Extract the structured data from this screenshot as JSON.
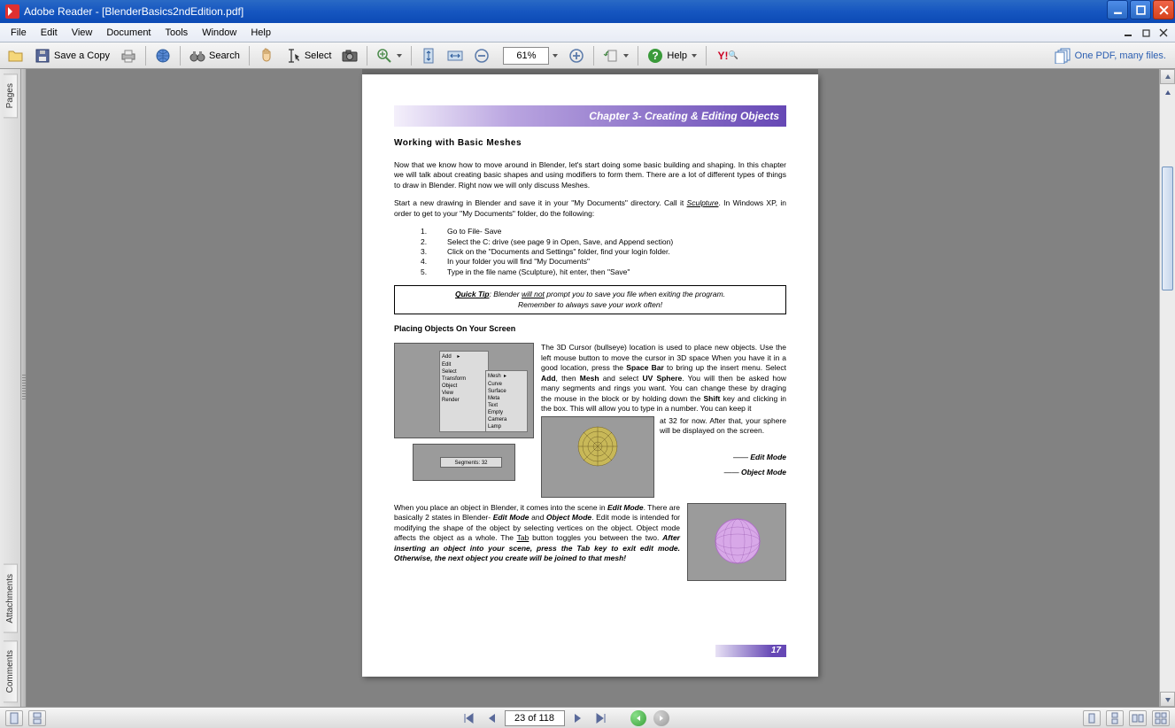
{
  "window": {
    "title": "Adobe Reader - [BlenderBasics2ndEdition.pdf]"
  },
  "menubar": {
    "items": [
      "File",
      "Edit",
      "View",
      "Document",
      "Tools",
      "Window",
      "Help"
    ]
  },
  "toolbar": {
    "save_copy": "Save a Copy",
    "search": "Search",
    "select": "Select",
    "zoom": "61%",
    "help": "Help",
    "onepdf": "One PDF, many files."
  },
  "sidebar": {
    "tabs": [
      "Pages",
      "Attachments",
      "Comments"
    ]
  },
  "navigation": {
    "page_display": "23 of 118"
  },
  "document": {
    "chapter_title": "Chapter 3- Creating & Editing Objects",
    "section": "Working with Basic Meshes",
    "intro": "Now that we know how to move around in Blender, let's start doing some basic building and shaping. In this chapter we will talk about creating basic shapes and using modifiers to form them. There are a lot of different types of things to draw in Blender. Right now we will only discuss Meshes.",
    "para2a": "Start a new drawing in Blender and save it in your \"My Documents\" directory. Call it ",
    "para2b": "Sculpture",
    "para2c": ". In Windows XP, in order to get to your \"My Documents\" folder, do the following:",
    "steps": [
      {
        "n": "1.",
        "t": "Go to File- Save"
      },
      {
        "n": "2.",
        "t": "Select the C: drive (see page 9 in Open, Save, and Append section)"
      },
      {
        "n": "3.",
        "t": "Click on the \"Documents and Settings\" folder, find your login folder."
      },
      {
        "n": "4.",
        "t": "In your folder you will find \"My Documents\""
      },
      {
        "n": "5.",
        "t": "Type in the file name (Sculpture), hit enter, then \"Save\""
      }
    ],
    "tip": {
      "label": "Quick Tip",
      "line1a": ": Blender ",
      "line1b": "will not",
      "line1c": " prompt you to save you file when exiting the program.",
      "line2": "Remember to always save your work often!"
    },
    "sub": "Placing Objects On Your Screen",
    "body1a": "The 3D Cursor (bullseye) location is used to place new objects. Use the left mouse button to move the cursor in 3D space When you have it in a good location, press the ",
    "body1b": "Space Bar",
    "body1c": " to bring up the insert menu. Select ",
    "body1d": "Add",
    "body1e": ", then ",
    "body1f": "Mesh",
    "body1g": " and select ",
    "body1h": "UV Sphere",
    "body1i": ". You will then be asked how many segments and rings you want. You can change these by draging the mouse in the block or by holding down the ",
    "body1j": "Shift",
    "body1k": " key and clicking in the box. This will allow you to type in a number. You can keep it",
    "body1l": "at 32 for now. After that, your sphere will be displayed on the screen.",
    "edit_mode": "Edit Mode",
    "object_mode": "Object Mode",
    "body2a": "When you place an object in Blender, it comes into the scene in ",
    "body2b": "Edit Mode",
    "body2c": ". There are basically 2 states in Blender- ",
    "body2d": "Edit Mode",
    "body2e": " and ",
    "body2f": "Object Mode",
    "body2g": ". Edit mode is intended for modifying the shape of the object by selecting vertices on the object. Object mode affects the object as a whole. The ",
    "body2h": "Tab",
    "body2i": " button toggles you between the two. ",
    "body2j": "After inserting an object into your scene, press the Tab key to exit edit mode. Otherwise, the next object you create will be joined to that mesh!",
    "page_number": "17"
  }
}
